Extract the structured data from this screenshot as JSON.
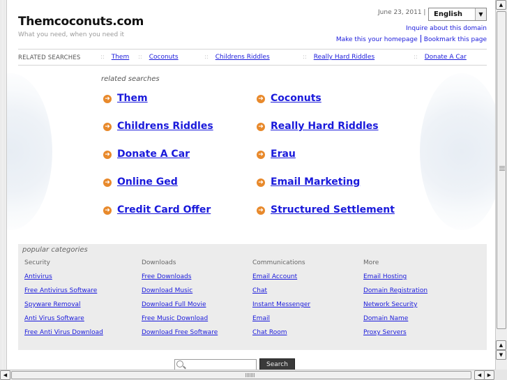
{
  "header": {
    "site_title": "Themcoconuts.com",
    "tagline": "What you need, when you need it",
    "date": "June 23, 2011 |",
    "language": "English",
    "inquire_link": "Inquire about this domain",
    "homepage_link": "Make this your homepage",
    "bookmark_link": "Bookmark this page"
  },
  "related_bar": {
    "title": "RELATED SEARCHES",
    "separator": "::",
    "items": [
      "Them",
      "Coconuts",
      "Childrens Riddles",
      "Really Hard Riddles",
      "Donate A Car"
    ]
  },
  "related": {
    "heading": "related searches",
    "bullet": "➜",
    "items": [
      "Them",
      "Coconuts",
      "Childrens Riddles",
      "Really Hard Riddles",
      "Donate A Car",
      "Erau",
      "Online Ged",
      "Email Marketing",
      "Credit Card Offer",
      "Structured Settlement"
    ]
  },
  "popular": {
    "title": "popular categories",
    "columns": [
      {
        "heading": "Security",
        "links": [
          "Antivirus",
          "Free Antivirus Software",
          "Spyware Removal",
          "Anti Virus Software",
          "Free Anti Virus Download"
        ]
      },
      {
        "heading": "Downloads",
        "links": [
          "Free Downloads",
          "Download Music",
          "Download Full Movie",
          "Free Music Download",
          "Download Free Software"
        ]
      },
      {
        "heading": "Communications",
        "links": [
          "Email Account",
          "Chat",
          "Instant Messenger",
          "Email",
          "Chat Room"
        ]
      },
      {
        "heading": "More",
        "links": [
          "Email Hosting",
          "Domain Registration",
          "Network Security",
          "Domain Name",
          "Proxy Servers"
        ]
      }
    ]
  },
  "search": {
    "button_label": "Search",
    "input_value": ""
  },
  "scrollbars": {
    "up_arrow": "▲",
    "down_arrow": "▼",
    "left_arrow": "◀",
    "right_arrow": "▶"
  },
  "colors": {
    "link": "#1a1adb",
    "bullet": "#e8892b",
    "panel": "#ececec"
  }
}
